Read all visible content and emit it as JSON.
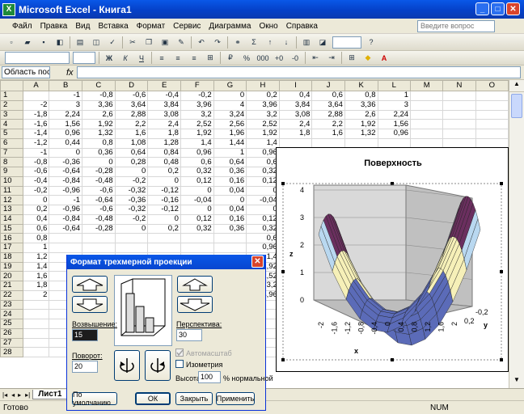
{
  "window": {
    "title": "Microsoft Excel - Книга1",
    "app_icon": "excel-icon"
  },
  "menu": [
    "Файл",
    "Правка",
    "Вид",
    "Вставка",
    "Формат",
    "Сервис",
    "Диаграмма",
    "Окно",
    "Справка"
  ],
  "help_placeholder": "Введите вопрос",
  "name_box": "Область пост...",
  "fx": "fx",
  "columns": [
    "A",
    "B",
    "C",
    "D",
    "E",
    "F",
    "G",
    "H",
    "I",
    "J",
    "K",
    "L",
    "M",
    "N",
    "O"
  ],
  "rows": [
    [
      "",
      "-1",
      "-0,8",
      "-0,6",
      "-0,4",
      "-0,2",
      "0",
      "0,2",
      "0,4",
      "0,6",
      "0,8",
      "1"
    ],
    [
      "-2",
      "3",
      "3,36",
      "3,64",
      "3,84",
      "3,96",
      "4",
      "3,96",
      "3,84",
      "3,64",
      "3,36",
      "3"
    ],
    [
      "-1,8",
      "2,24",
      "2,6",
      "2,88",
      "3,08",
      "3,2",
      "3,24",
      "3,2",
      "3,08",
      "2,88",
      "2,6",
      "2,24"
    ],
    [
      "-1,6",
      "1,56",
      "1,92",
      "2,2",
      "2,4",
      "2,52",
      "2,56",
      "2,52",
      "2,4",
      "2,2",
      "1,92",
      "1,56"
    ],
    [
      "-1,4",
      "0,96",
      "1,32",
      "1,6",
      "1,8",
      "1,92",
      "1,96",
      "1,92",
      "1,8",
      "1,6",
      "1,32",
      "0,96"
    ],
    [
      "-1,2",
      "0,44",
      "0,8",
      "1,08",
      "1,28",
      "1,4",
      "1,44",
      "1,4",
      "",
      "",
      "",
      ""
    ],
    [
      "-1",
      "0",
      "0,36",
      "0,64",
      "0,84",
      "0,96",
      "1",
      "0,96",
      "",
      "",
      "",
      ""
    ],
    [
      "-0,8",
      "-0,36",
      "0",
      "0,28",
      "0,48",
      "0,6",
      "0,64",
      "0,6",
      "",
      "",
      "",
      ""
    ],
    [
      "-0,6",
      "-0,64",
      "-0,28",
      "0",
      "0,2",
      "0,32",
      "0,36",
      "0,32",
      "",
      "",
      "",
      ""
    ],
    [
      "-0,4",
      "-0,84",
      "-0,48",
      "-0,2",
      "0",
      "0,12",
      "0,16",
      "0,12",
      "",
      "",
      "",
      ""
    ],
    [
      "-0,2",
      "-0,96",
      "-0,6",
      "-0,32",
      "-0,12",
      "0",
      "0,04",
      "0",
      "",
      "",
      "",
      ""
    ],
    [
      "0",
      "-1",
      "-0,64",
      "-0,36",
      "-0,16",
      "-0,04",
      "0",
      "-0,04",
      "",
      "",
      "",
      ""
    ],
    [
      "0,2",
      "-0,96",
      "-0,6",
      "-0,32",
      "-0,12",
      "0",
      "0,04",
      "0",
      "",
      "",
      "",
      ""
    ],
    [
      "0,4",
      "-0,84",
      "-0,48",
      "-0,2",
      "0",
      "0,12",
      "0,16",
      "0,12",
      "",
      "",
      "",
      ""
    ],
    [
      "0,6",
      "-0,64",
      "-0,28",
      "0",
      "0,2",
      "0,32",
      "0,36",
      "0,32",
      "",
      "",
      "",
      ""
    ],
    [
      "0,8",
      "",
      "",
      "",
      "",
      "",
      "",
      "0,6",
      "",
      "",
      "",
      ""
    ],
    [
      "1",
      "",
      "",
      "",
      "",
      "",
      "",
      "0,96",
      "",
      "",
      "",
      ""
    ],
    [
      "1,2",
      "",
      "",
      "",
      "",
      "",
      "",
      "1,4",
      "",
      "",
      "",
      ""
    ],
    [
      "1,4",
      "",
      "",
      "",
      "",
      "",
      "",
      "1,92",
      "",
      "",
      "",
      ""
    ],
    [
      "1,6",
      "",
      "",
      "",
      "",
      "",
      "",
      "2,52",
      "",
      "",
      "",
      ""
    ],
    [
      "1,8",
      "",
      "",
      "",
      "",
      "",
      "",
      "3,2",
      "",
      "",
      "",
      ""
    ],
    [
      "2",
      "",
      "",
      "",
      "",
      "",
      "",
      "3,96",
      "",
      "",
      "",
      ""
    ],
    [
      "",
      "",
      "",
      "",
      "",
      "",
      "",
      "",
      "",
      "",
      "",
      ""
    ],
    [
      "",
      "",
      "",
      "",
      "",
      "",
      "",
      "",
      "",
      "",
      "",
      ""
    ],
    [
      "",
      "",
      "",
      "",
      "",
      "",
      "",
      "",
      "",
      "",
      "",
      ""
    ],
    [
      "",
      "",
      "",
      "",
      "",
      "",
      "",
      "",
      "",
      "",
      "",
      ""
    ],
    [
      "",
      "",
      "",
      "",
      "",
      "",
      "",
      "",
      "",
      "",
      "",
      ""
    ],
    [
      "",
      "",
      "",
      "",
      "",
      "",
      "",
      "",
      "",
      "",
      "",
      ""
    ]
  ],
  "sheet_tab": "Лист1",
  "status": {
    "ready": "Готово",
    "num": "NUM"
  },
  "chart_data": {
    "type": "surface",
    "title": "Поверхность",
    "z_label": "z",
    "x_label": "x",
    "y_label": "y",
    "z_ticks": [
      "0",
      "1",
      "2",
      "3",
      "4"
    ],
    "x_ticks": [
      "-2",
      "-1,6",
      "-1,2",
      "-0,8",
      "-0,4",
      "0",
      "0,4",
      "0,8",
      "1,2",
      "1,6",
      "2"
    ],
    "y_ticks": [
      "-0,2",
      "0,2"
    ],
    "bands": [
      "#6b2f5f",
      "#b9d8f0",
      "#f6f0b8",
      "#5b6bb8"
    ]
  },
  "dialog": {
    "title": "Формат трехмерной проекции",
    "elevation_label": "Возвышение:",
    "elevation_value": "15",
    "rotation_label": "Поворот:",
    "rotation_value": "20",
    "perspective_label": "Перспектива:",
    "perspective_value": "30",
    "autoscale_label": "Автомасштаб",
    "isometry_label": "Изометрия",
    "height_label": "Высота:",
    "height_value": "100",
    "height_unit": "% нормальной",
    "default_button": "По умолчанию",
    "ok_button": "ОК",
    "close_button": "Закрыть",
    "apply_button": "Применить"
  }
}
